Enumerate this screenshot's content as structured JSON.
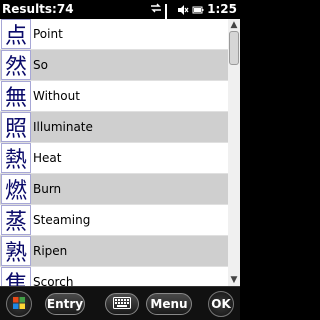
{
  "status_bar": {
    "title": "Results:74",
    "time": "1:25"
  },
  "list": {
    "items": [
      {
        "kanji": "点",
        "meaning": "Point"
      },
      {
        "kanji": "然",
        "meaning": "So"
      },
      {
        "kanji": "無",
        "meaning": "Without"
      },
      {
        "kanji": "照",
        "meaning": "Illuminate"
      },
      {
        "kanji": "熱",
        "meaning": "Heat"
      },
      {
        "kanji": "燃",
        "meaning": "Burn"
      },
      {
        "kanji": "蒸",
        "meaning": "Steaming"
      },
      {
        "kanji": "熟",
        "meaning": "Ripen"
      },
      {
        "kanji": "焦",
        "meaning": "Scorch"
      }
    ]
  },
  "toolbar": {
    "entry_label": "Entry",
    "menu_label": "Menu",
    "ok_label": "OK"
  }
}
